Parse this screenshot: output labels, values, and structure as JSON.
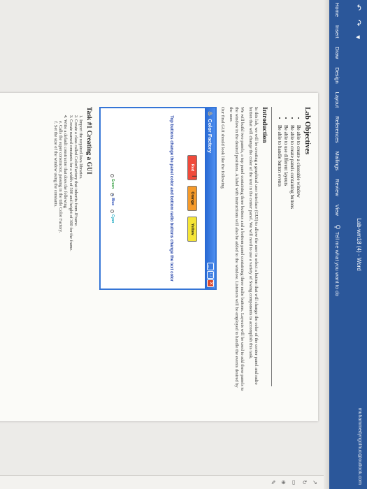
{
  "window": {
    "title": "Lab-wm18 (4) - Word",
    "user": "muhammedyngolhuo@outlook.com",
    "quick_access_icons": "↶ ↷ ▾"
  },
  "ribbon": {
    "tabs": [
      "Home",
      "Insert",
      "Draw",
      "Design",
      "Layout",
      "References",
      "Mailings",
      "Review",
      "View"
    ],
    "tell_me_placeholder": "Tell me what you want to do",
    "icons": {
      "tell_me": "lightbulb-icon"
    }
  },
  "document": {
    "objectives_heading": "Lab Objectives",
    "objectives": [
      "Be able to create a closeable window",
      "Be able to create panels containing buttons",
      "Be able to use different layouts",
      "Be able to handle button events"
    ],
    "intro_heading": "Introduction",
    "intro_p1": "In this lab, we will be creating a graphical user interface (GUI) to allow the user to select a button that will change the color of the center panel and radio button that will change the color of the text in the center panel. We will need to use a variety of Swing components to accomplish this task.",
    "intro_p2": "We will build two panels, a top panel containing three buttons and a bottom panel containing three radio buttons. Layouts will be used to add these panels to the window in the desired positions. A label with instructions will also be added to the window. Listeners will be employed to handle the events desired by the user.",
    "intro_p3": "Our final GUI should look like the following",
    "task_heading": "Task #1 Creating a GUI",
    "task_steps": [
      "Import the required Java libraries.",
      "Create a class called ColorFactory that inherits from JFrame.",
      "Create named constants for a width of 500 and height of 300 for the frame.",
      "Write a default constructor that does the following"
    ],
    "task_substeps": [
      "Calls the super constructor, passing in the title Color Factory.",
      "Set the size of the window using the constants."
    ]
  },
  "gui_preview": {
    "title": "Color Factory",
    "buttons": [
      {
        "label": "Red",
        "color": "#f04a3b",
        "text_color": "#ffffff"
      },
      {
        "label": "Orange",
        "color": "#f59a2a",
        "text_color": "#111111"
      },
      {
        "label": "Yellow",
        "color": "#f5e536",
        "text_color": "#111111"
      }
    ],
    "instructions": "Top buttons change the panel color and bottom radio buttons change the text color",
    "radios": [
      {
        "label": "Green",
        "color": "#2e9b3a",
        "selected": false
      },
      {
        "label": "Blue",
        "color": "#1a3fb0",
        "selected": true
      },
      {
        "label": "Cyan",
        "color": "#18a8c0",
        "selected": false
      }
    ],
    "controls": {
      "minimize": "_",
      "maximize": "□",
      "close": "✕"
    }
  },
  "side_panel": {
    "glyphs": [
      "↗",
      "↻",
      "▭",
      "⊕",
      "✎"
    ]
  }
}
